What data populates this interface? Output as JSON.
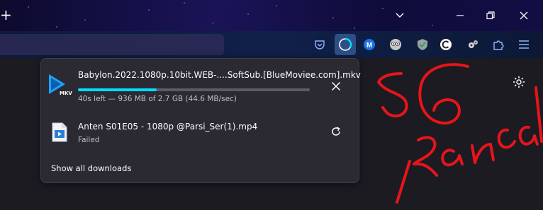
{
  "window": {
    "new_tab_glyph": "+",
    "controls": [
      "chevron-down-icon",
      "minimize-icon",
      "restore-icon",
      "close-icon"
    ]
  },
  "toolbar": {
    "icons": [
      "pocket-icon",
      "downloads-icon",
      "extension-m-icon",
      "extension-owl-icon",
      "extension-shield-check-icon",
      "extension-c-icon",
      "extension-gears-icon",
      "extensions-puzzle-icon",
      "menu-icon"
    ],
    "accent": "#00ddff"
  },
  "downloads": {
    "items": [
      {
        "filename": "Babylon.2022.1080p.10bit.WEB-....SoftSub.[BlueMoviee.com].mkv",
        "status": "40s left — 936 MB of 2.7 GB (44.6 MB/sec)",
        "progress_fraction": 0.34,
        "file_type_label": "MKV",
        "action": "cancel"
      },
      {
        "filename": "Anten S01E05 - 1080p @Parsi_Ser(1).mp4",
        "status": "Failed",
        "action": "retry"
      }
    ],
    "show_all_label": "Show all downloads"
  }
}
